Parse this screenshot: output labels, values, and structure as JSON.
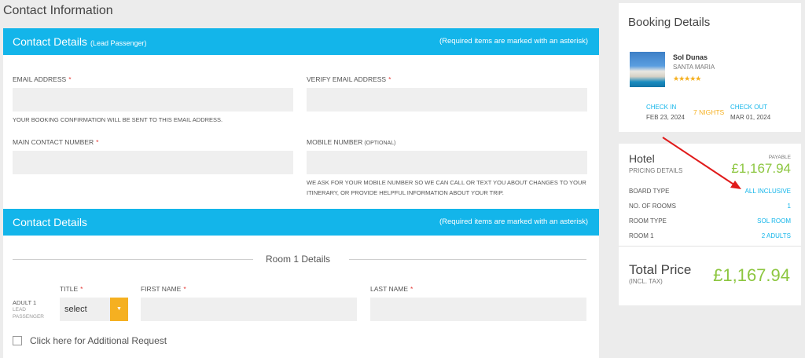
{
  "page_title": "Contact Information",
  "contact_section": {
    "title": "Contact Details",
    "subtitle": "(Lead Passenger)",
    "required_note": "(Required items are marked with an asterisk)",
    "email_label": "Email Address",
    "verify_email_label": "Verify Email Address",
    "email_hint": "Your booking confirmation will be sent to this email address.",
    "main_contact_label": "Main Contact Number",
    "mobile_label": "Mobile Number",
    "mobile_optional": "(Optional)",
    "mobile_hint": "We ask for your mobile number so we can call or text you about changes to your itinerary, or provide helpful information about your trip.",
    "required_mark": "*"
  },
  "passenger_section": {
    "title": "Contact Details",
    "required_note": "(Required items are marked with an asterisk)",
    "room_title": "Room 1 Details",
    "adult_label": "ADULT 1",
    "adult_sub_1": "LEAD",
    "adult_sub_2": "PASSENGER",
    "title_label": "Title",
    "title_value": "select",
    "first_name_label": "First Name",
    "last_name_label": "Last Name",
    "additional_request": "Click here for Additional Request"
  },
  "booking": {
    "title": "Booking Details",
    "hotel_name": "Sol Dunas",
    "location": "SANTA MARIA",
    "stars": "★★★★★",
    "rating": 5,
    "check_in_label": "Check In",
    "check_in_date": "FEB 23, 2024",
    "nights": "7 NIGHTS",
    "check_out_label": "Check Out",
    "check_out_date": "MAR 01, 2024"
  },
  "pricing": {
    "section": "Hotel",
    "subtitle": "Pricing Details",
    "payable_label": "Payable",
    "payable_amount": "£1,167.94",
    "rows": [
      {
        "label": "Board Type",
        "value": "All Inclusive"
      },
      {
        "label": "No. of Rooms",
        "value": "1"
      },
      {
        "label": "Room Type",
        "value": "Sol Room"
      },
      {
        "label": "Room 1",
        "value": "2 Adults"
      }
    ],
    "total_label": "Total Price",
    "total_sub": "(INCL. TAX)",
    "total_amount": "£1,167.94"
  },
  "colors": {
    "accent": "#13b5ea",
    "price": "#8cc63f",
    "required": "#e53935",
    "select_button": "#f5b021",
    "annotation_arrow": "#e01b1b"
  }
}
